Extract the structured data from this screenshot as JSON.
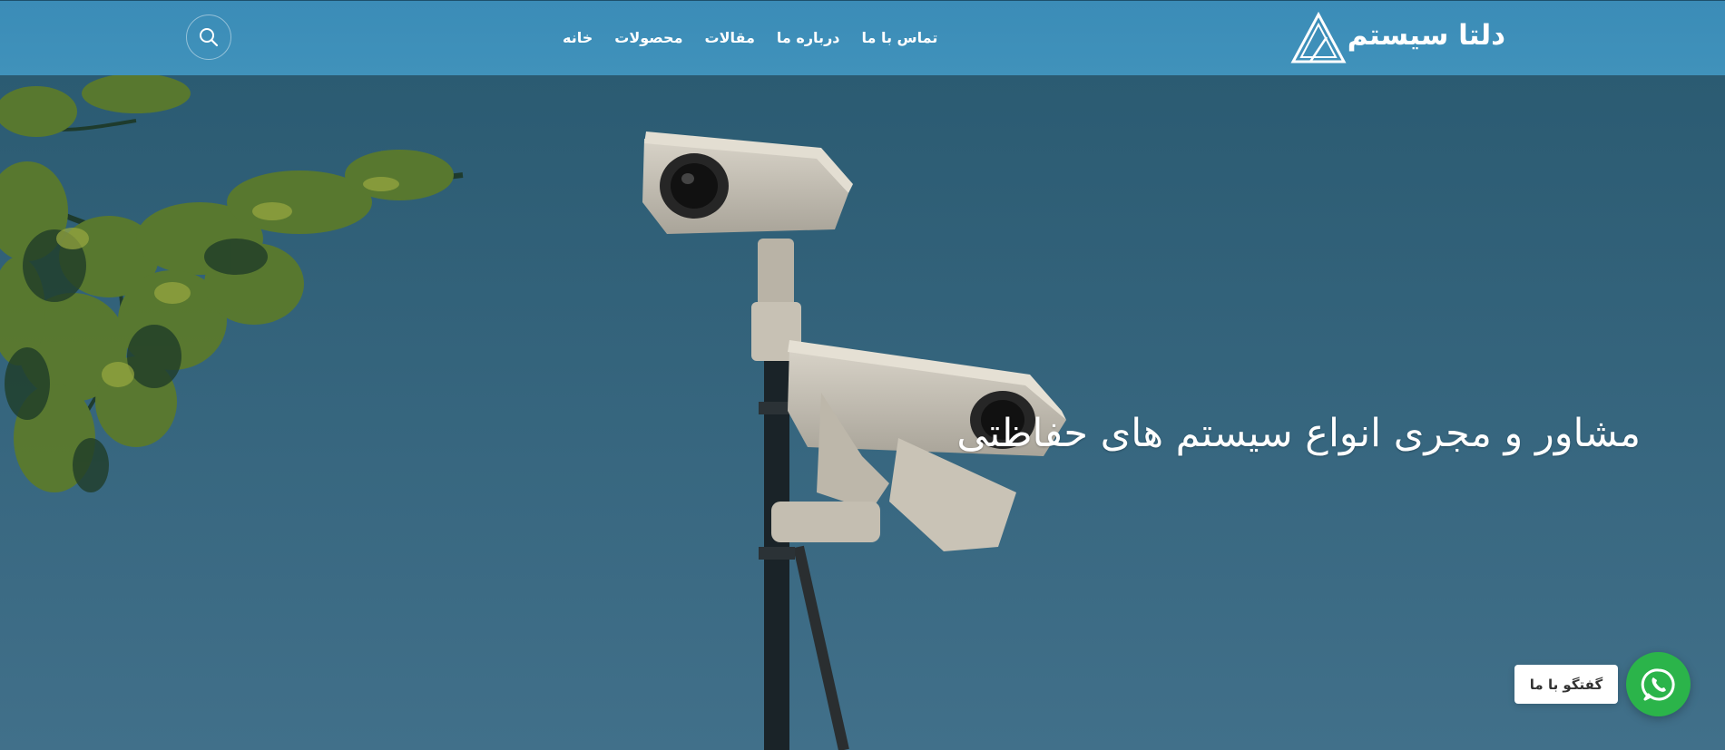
{
  "header": {
    "logo_text": "دلتا سیستم",
    "nav": [
      {
        "label": "خانه"
      },
      {
        "label": "محصولات"
      },
      {
        "label": "مقالات"
      },
      {
        "label": "درباره ما"
      },
      {
        "label": "تماس با ما"
      }
    ],
    "search_icon": "search-icon"
  },
  "hero": {
    "title": "مشاور و مجری انواع سیستم های حفاظتی"
  },
  "chat": {
    "label": "گفتگو با ما",
    "icon": "whatsapp-icon",
    "color": "#2bb44a"
  },
  "colors": {
    "header_bg": "#3d8fba",
    "hero_bg": "#2f5d75"
  }
}
